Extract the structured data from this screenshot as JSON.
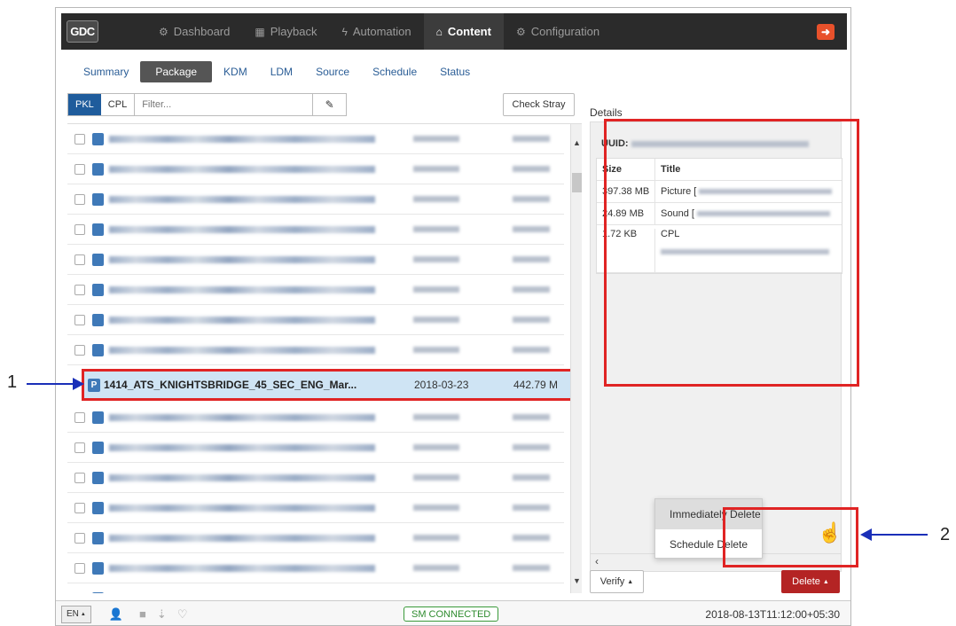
{
  "app": {
    "logo": "GDC",
    "nav": [
      {
        "label": "Dashboard",
        "icon": "dashboard-icon"
      },
      {
        "label": "Playback",
        "icon": "film-icon"
      },
      {
        "label": "Automation",
        "icon": "bolt-icon"
      },
      {
        "label": "Content",
        "icon": "content-icon"
      },
      {
        "label": "Configuration",
        "icon": "gears-icon"
      }
    ],
    "active_nav": "Content"
  },
  "subtabs": [
    "Summary",
    "Package",
    "KDM",
    "LDM",
    "Source",
    "Schedule",
    "Status"
  ],
  "active_subtab": "Package",
  "filterbar": {
    "pkl_label": "PKL",
    "cpl_label": "CPL",
    "filter_placeholder": "Filter...",
    "check_stray_label": "Check Stray"
  },
  "selected_row": {
    "badge": "P",
    "name": "1414_ATS_KNIGHTSBRIDGE_45_SEC_ENG_Mar...",
    "date": "2018-03-23",
    "size": "442.79 M"
  },
  "details": {
    "title": "Details",
    "uuid_label": "UUID:",
    "headers": {
      "size": "Size",
      "title": "Title"
    },
    "rows": [
      {
        "size": "397.38 MB",
        "title": "Picture ["
      },
      {
        "size": "24.89 MB",
        "title": "Sound ["
      },
      {
        "size": "1.72 KB",
        "title": "CPL"
      }
    ]
  },
  "dropdown": {
    "items": [
      "Immediately Delete",
      "Schedule Delete"
    ]
  },
  "buttons": {
    "verify": "Verify",
    "delete": "Delete"
  },
  "footer": {
    "lang": "EN",
    "status": "SM CONNECTED",
    "datetime": "2018-08-13T11:12:00+05:30"
  },
  "annotations": {
    "callout1": "1",
    "callout2": "2"
  },
  "colors": {
    "navbar": "#2b2b2b",
    "accent_blue": "#1f5c9c",
    "delete_red": "#b42424",
    "highlight_red": "#e02424",
    "arrow_blue": "#1a2fb8",
    "status_green": "#2e8b2e"
  }
}
